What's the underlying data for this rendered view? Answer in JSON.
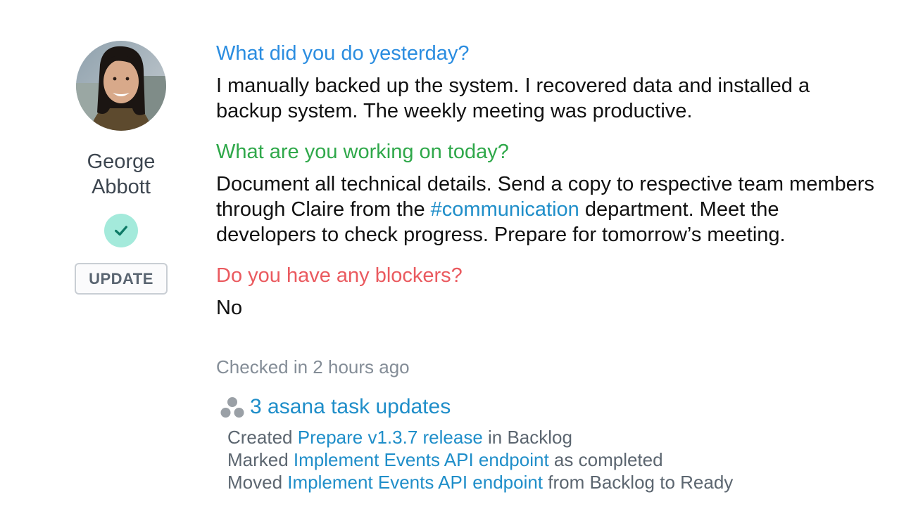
{
  "user": {
    "name_line1": "George",
    "name_line2": "Abbott",
    "update_button": "UPDATE",
    "status_icon": "check-icon"
  },
  "standup": {
    "yesterday": {
      "question": "What did you do yesterday?",
      "answer": "I manually backed up the system. I recovered data and installed a backup system. The weekly meeting was productive."
    },
    "today": {
      "question": "What are you working on today?",
      "answer_part1": "Document all technical details. Send a copy to respective team members through Claire from the ",
      "hashtag": "#communication",
      "answer_part2": " department. Meet the developers to check progress. Prepare for tomorrow’s meeting."
    },
    "blockers": {
      "question": "Do you have any blockers?",
      "answer": "No"
    }
  },
  "checked_in": "Checked in 2 hours ago",
  "asana": {
    "icon": "asana-icon",
    "header": "3 asana task updates",
    "updates": [
      {
        "prefix": "Created ",
        "task": "Prepare v1.3.7 release",
        "suffix": " in Backlog"
      },
      {
        "prefix": "Marked ",
        "task": "Implement Events API endpoint",
        "suffix": " as completed"
      },
      {
        "prefix": "Moved ",
        "task": "Implement Events API endpoint",
        "suffix": " from Backlog to Ready"
      }
    ]
  },
  "colors": {
    "question_yesterday": "#2b8de0",
    "question_today": "#2fa84a",
    "question_blockers": "#ea5a5f",
    "link": "#1f8ec9",
    "status_badge": "#a4eadb"
  }
}
